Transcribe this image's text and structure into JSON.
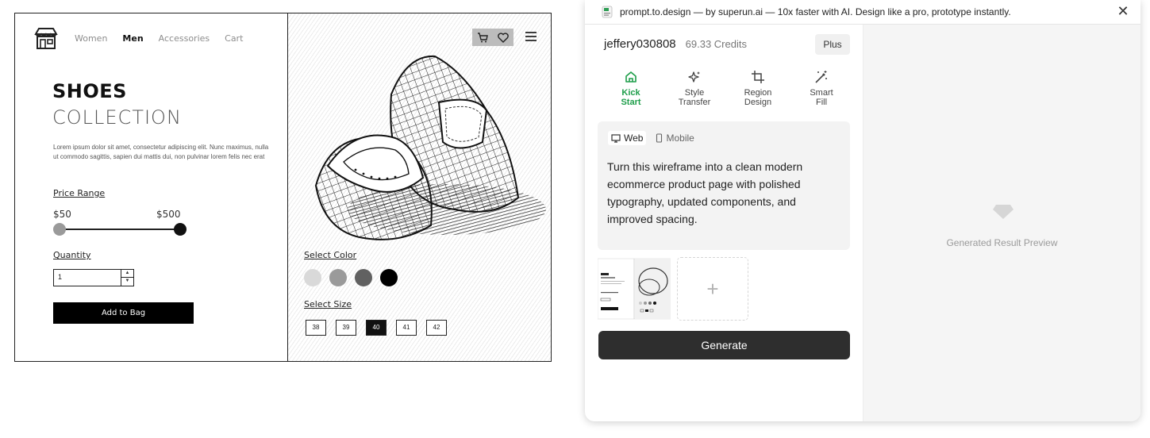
{
  "wireframe": {
    "nav": [
      "Women",
      "Men",
      "Accessories",
      "Cart"
    ],
    "title_line1": "SHOES",
    "title_line2": "COLLECTION",
    "description": "Lorem ipsum dolor sit amet, consectetur adipiscing elit. Nunc maximus, nulla ut commodo sagittis, sapien dui mattis dui, non pulvinar lorem felis nec erat",
    "price_label": "Price Range",
    "price_min": "$50",
    "price_max": "$500",
    "quantity_label": "Quantity",
    "quantity_value": "1",
    "add_button": "Add to Bag",
    "color_label": "Select Color",
    "colors": [
      "#d9d9d9",
      "#9a9a9a",
      "#616161",
      "#000000"
    ],
    "size_label": "Select Size",
    "sizes": [
      "38",
      "39",
      "40",
      "41",
      "42"
    ],
    "selected_size": "40"
  },
  "panel": {
    "header_title": "prompt.to.design — by superun.ai — 10x faster with AI. Design like a pro, prototype instantly.",
    "username": "jeffery030808",
    "credits": "69.33 Credits",
    "plan": "Plus",
    "modes": [
      {
        "label_line1": "Kick",
        "label_line2": "Start",
        "icon": "home-icon"
      },
      {
        "label_line1": "Style",
        "label_line2": "Transfer",
        "icon": "sparkles-icon"
      },
      {
        "label_line1": "Region",
        "label_line2": "Design",
        "icon": "crop-icon"
      },
      {
        "label_line1": "Smart",
        "label_line2": "Fill",
        "icon": "magic-wand-icon"
      }
    ],
    "active_mode": "Kick Start",
    "accent_color": "#1e9e4a",
    "device_tabs": [
      "Web",
      "Mobile"
    ],
    "active_device": "Web",
    "prompt": "Turn this wireframe into a clean modern ecommerce product page with polished typography, updated components, and improved spacing.",
    "add_image": "+",
    "generate_label": "Generate",
    "preview_label": "Generated Result Preview"
  }
}
